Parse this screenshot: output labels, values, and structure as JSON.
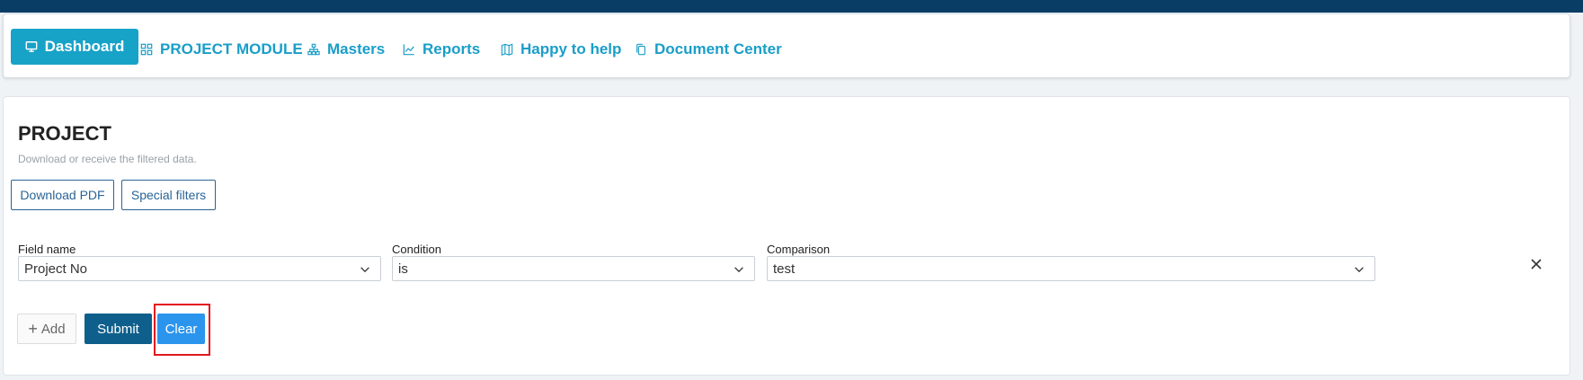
{
  "nav": {
    "items": [
      {
        "label": "Dashboard",
        "icon": "monitor-icon"
      },
      {
        "label": "PROJECT MODULE",
        "icon": "grid-icon"
      },
      {
        "label": "Masters",
        "icon": "sitemap-icon"
      },
      {
        "label": "Reports",
        "icon": "chart-line-icon"
      },
      {
        "label": "Happy to help",
        "icon": "map-icon"
      },
      {
        "label": "Document Center",
        "icon": "copy-icon"
      }
    ]
  },
  "page": {
    "title": "PROJECT",
    "subtitle": "Download or receive the filtered data."
  },
  "actions": {
    "download_pdf": "Download PDF",
    "special_filters": "Special filters"
  },
  "filter": {
    "field_label": "Field name",
    "field_value": "Project No",
    "condition_label": "Condition",
    "condition_value": "is",
    "comparison_label": "Comparison",
    "comparison_value": "test"
  },
  "buttons": {
    "add": "Add",
    "submit": "Submit",
    "clear": "Clear"
  },
  "colors": {
    "topbar": "#0a3d66",
    "nav_accent": "#17a2c8",
    "submit": "#0f5f8c",
    "clear": "#2b95ee",
    "highlight": "#e3161e"
  }
}
